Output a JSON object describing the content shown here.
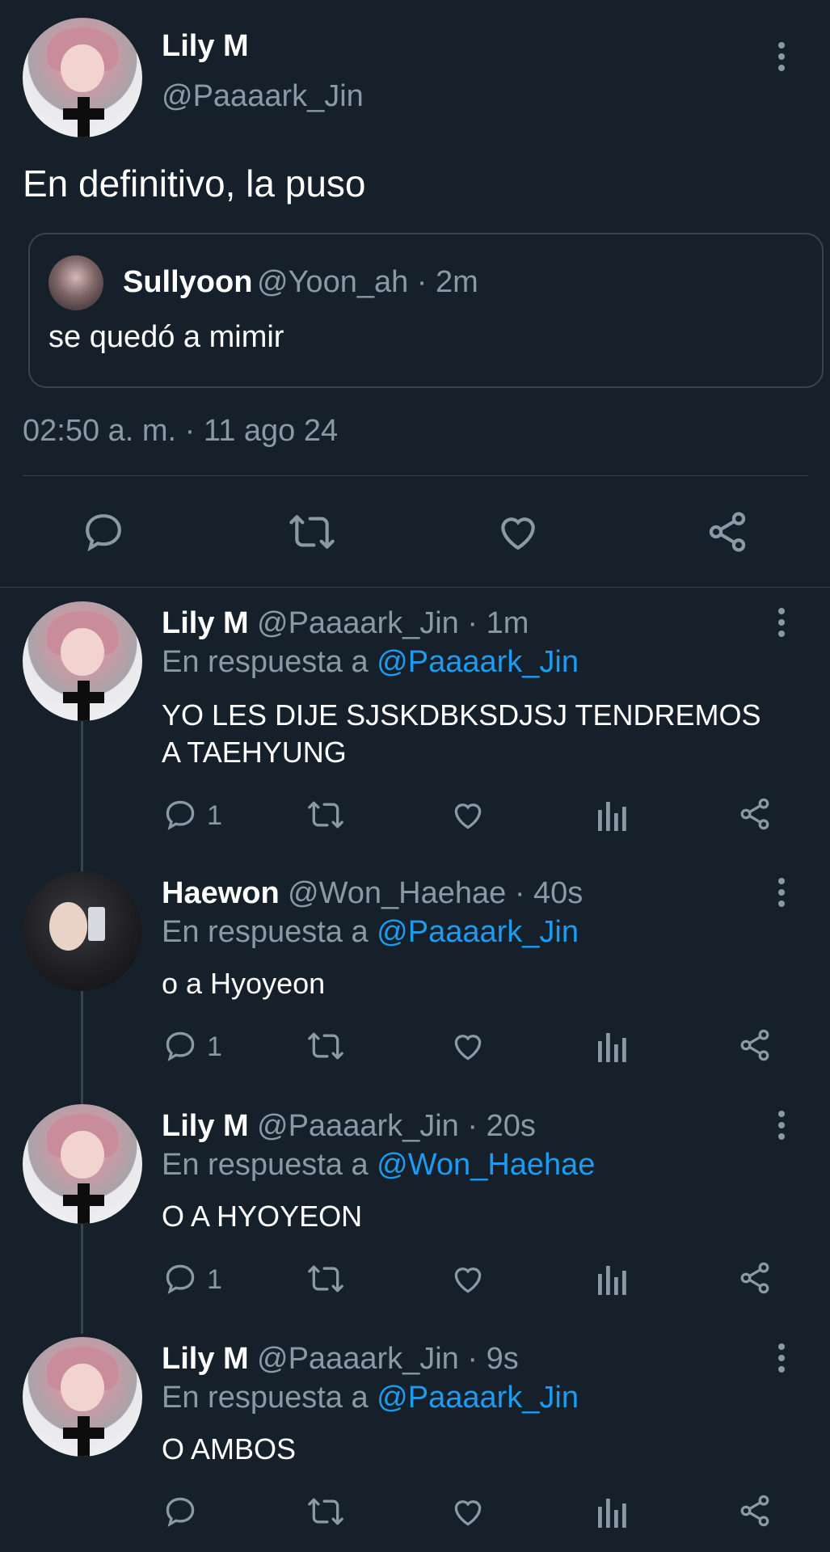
{
  "main_tweet": {
    "author_name": "Lily M",
    "author_handle": "@Paaaark_Jin",
    "text": "En definitivo, la puso",
    "timestamp": "02:50 a. m. · 11 ago 24",
    "quoted": {
      "author_name": "Sullyoon",
      "author_handle_time": "@Yoon_ah · 2m",
      "text": "se quedó a mimir"
    }
  },
  "replies": [
    {
      "author_name": "Lily M",
      "handle_time": "@Paaaark_Jin · 1m",
      "reply_prefix": "En respuesta a",
      "reply_to": "@Paaaark_Jin",
      "text_line1": "YO LES DIJE SJSKDBKSDJSJ TENDREMOS",
      "text_line2": "A TAEHYUNG",
      "reply_count": "1"
    },
    {
      "author_name": "Haewon",
      "handle_time": "@Won_Haehae · 40s",
      "reply_prefix": "En respuesta a",
      "reply_to": "@Paaaark_Jin",
      "text_line1": "o a Hyoyeon",
      "reply_count": "1"
    },
    {
      "author_name": "Lily M",
      "handle_time": "@Paaaark_Jin · 20s",
      "reply_prefix": "En respuesta a",
      "reply_to": "@Won_Haehae",
      "text_line1": "O A HYOYEON",
      "reply_count": "1"
    },
    {
      "author_name": "Lily M",
      "handle_time": "@Paaaark_Jin · 9s",
      "reply_prefix": "En respuesta a",
      "reply_to": "@Paaaark_Jin",
      "text_line1": "O AMBOS",
      "reply_count": ""
    }
  ],
  "colors": {
    "background": "#15202b",
    "muted": "#8b98a5",
    "link": "#1d9bf0",
    "divider": "#38444d"
  }
}
